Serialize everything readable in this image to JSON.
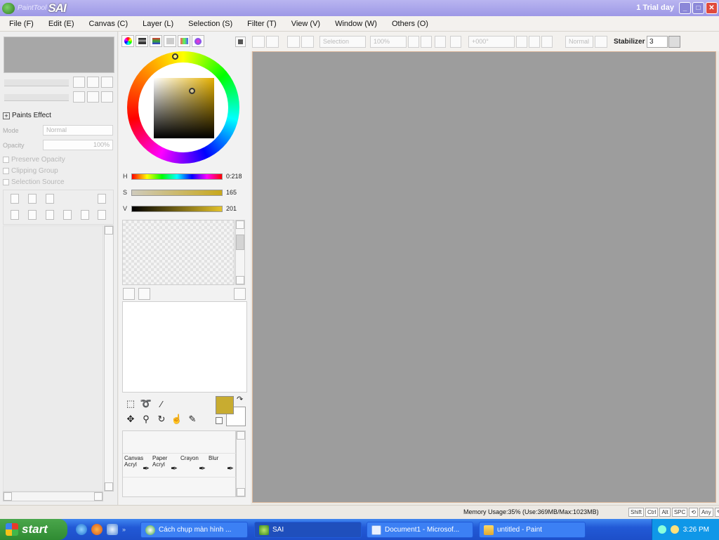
{
  "window": {
    "logo_text_small": "PaintTool",
    "app_name": "SAI",
    "trial_text": "1 Trial day",
    "min_glyph": "_",
    "max_glyph": "□",
    "close_glyph": "✕"
  },
  "menu": [
    {
      "label": "File (F)"
    },
    {
      "label": "Edit (E)"
    },
    {
      "label": "Canvas (C)"
    },
    {
      "label": "Layer (L)"
    },
    {
      "label": "Selection (S)"
    },
    {
      "label": "Filter (T)"
    },
    {
      "label": "View (V)"
    },
    {
      "label": "Window (W)"
    },
    {
      "label": "Others (O)"
    }
  ],
  "layer_panel": {
    "paints_effect": "Paints Effect",
    "mode_label": "Mode",
    "mode_value": "Normal",
    "opacity_label": "Opacity",
    "opacity_value": "100%",
    "preserve_opacity": "Preserve Opacity",
    "clipping_group": "Clipping Group",
    "selection_source": "Selection Source"
  },
  "color": {
    "h_label": "H",
    "h_value": "0:218",
    "s_label": "S",
    "s_value": "165",
    "v_label": "V",
    "v_value": "201",
    "primary": "#c8ac30",
    "secondary": "#ffffff"
  },
  "brushes": [
    {
      "label": "Canvas Acryl"
    },
    {
      "label": "Paper Acryl"
    },
    {
      "label": "Crayon"
    },
    {
      "label": "Blur"
    }
  ],
  "toolbar": {
    "selection_label": "Selection",
    "zoom_value": "100%",
    "angle_value": "+000°",
    "blend_value": "Normal",
    "stabilizer_label": "Stabilizer",
    "stabilizer_value": "3"
  },
  "status": {
    "memory": "Memory Usage:35% (Use:369MB/Max:1023MB)",
    "keys": [
      "Shift",
      "Ctrl",
      "Alt",
      "SPC"
    ],
    "any_label": "Any"
  },
  "taskbar": {
    "start_label": "start",
    "tasks": [
      {
        "label": "Cách chụp màn hình ..."
      },
      {
        "label": "SAI"
      },
      {
        "label": "Document1 - Microsof..."
      },
      {
        "label": "untitled - Paint"
      }
    ],
    "clock": "3:26 PM"
  }
}
